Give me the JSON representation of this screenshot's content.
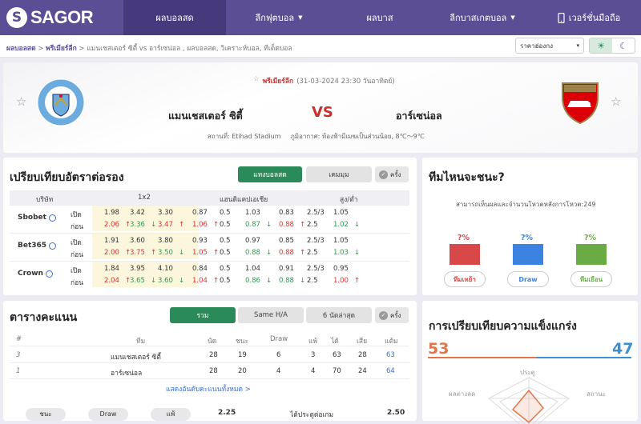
{
  "brand": {
    "logo_glyph": "S",
    "name": "SAGOR"
  },
  "nav": {
    "items": [
      "ผลบอลสด",
      "ลีกฟุตบอล",
      "ผลบาส",
      "ลีกบาสเกตบอล",
      "เวอร์ชั่นมือถือ"
    ],
    "active": 0,
    "dropdown_icon": "▼"
  },
  "breadcrumb": {
    "home": "ผลบอลสด",
    "sep": ">",
    "league": "พรีเมียร์ลีก",
    "rest": "แมนเชสเตอร์ ซิตี้ vs อาร์เซน่อล , ผลบอลสด, วิเคราะห์บอล, ทีเด็ดบอล"
  },
  "region_select": {
    "value": "ราคาฮ่องกง"
  },
  "theme": {
    "light_icon": "☀",
    "dark_icon": "☾"
  },
  "match": {
    "league": "พรีเมียร์ลีก",
    "datetime": "(31-03-2024 23:30 วันอาทิตย์)",
    "home": "แมนเชสเตอร์ ซิตี้",
    "away": "อาร์เซน่อล",
    "vs": "VS",
    "venue": "สถานที่: Etihad Stadium",
    "weather": "ภูมิอากาศ: ท้องฟ้ามีเมฆเป็นส่วนน้อย, 8℃～9℃",
    "home_crest_text": "MANCHESTER CITY",
    "away_crest_text": "Arsenal"
  },
  "odds": {
    "title": "เปรียบเทียบอัตราต่อรอง",
    "tab_active": "แทงบอลสด",
    "tab_other": "เคมมุม",
    "check": "ครั้ง",
    "head": {
      "company": "บริษัท",
      "x12": "1x2",
      "handicap": "แฮนดิแคปเอเชีย",
      "ou": "สูง/ต่ำ"
    },
    "open_label": "เปิด",
    "close_label": "ก่อน",
    "rows": [
      {
        "book": "Sbobet",
        "open": [
          "1.98",
          "3.42",
          "3.30",
          "0.87",
          "0.5",
          "1.03",
          "0.83",
          "2.5/3",
          "1.05"
        ],
        "close": [
          "2.06",
          "3.36",
          "3.47",
          "1.06",
          "0.5",
          "0.87",
          "0.88",
          "2.5",
          "1.02"
        ],
        "dir": [
          "up",
          "dn",
          "up",
          "up",
          "",
          "dn",
          "up",
          "",
          "dn"
        ]
      },
      {
        "book": "Bet365",
        "open": [
          "1.91",
          "3.60",
          "3.80",
          "0.93",
          "0.5",
          "0.97",
          "0.85",
          "2.5/3",
          "1.05"
        ],
        "close": [
          "2.00",
          "3.75",
          "3.50",
          "1.05",
          "0.5",
          "0.88",
          "0.88",
          "2.5",
          "1.03"
        ],
        "dir": [
          "up",
          "up",
          "dn",
          "up",
          "",
          "dn",
          "up",
          "",
          "dn"
        ]
      },
      {
        "book": "Crown",
        "open": [
          "1.84",
          "3.95",
          "4.10",
          "0.84",
          "0.5",
          "1.04",
          "0.91",
          "2.5/3",
          "0.95"
        ],
        "close": [
          "2.04",
          "3.65",
          "3.60",
          "1.04",
          "0.5",
          "0.86",
          "0.88",
          "2.5",
          "1.00"
        ],
        "dir": [
          "up",
          "dn",
          "dn",
          "up",
          "",
          "dn",
          "dn",
          "",
          "up"
        ]
      }
    ]
  },
  "standings": {
    "title": "ตารางคะแนน",
    "tabs": [
      "รวม",
      "Same H/A",
      "6 นัดล่าสุด"
    ],
    "check": "ครั้ง",
    "head": [
      "#",
      "ทีม",
      "นัด",
      "ชนะ",
      "Draw",
      "แพ้",
      "ได้",
      "เสีย",
      "แต้ม"
    ],
    "rows": [
      [
        "3",
        "แมนเชสเตอร์ ซิตี้",
        "28",
        "19",
        "6",
        "3",
        "63",
        "28",
        "63"
      ],
      [
        "1",
        "อาร์เซน่อล",
        "28",
        "20",
        "4",
        "4",
        "70",
        "24",
        "64"
      ]
    ],
    "show_all": "แสดงอันดับคะแนนทั้งหมด >",
    "bottom": {
      "pills": [
        "ชนะ",
        "Draw",
        "แพ้"
      ],
      "value1": "2.25",
      "label2": "ได้ประตูต่อเกม",
      "value2": "2.50"
    }
  },
  "predict": {
    "title": "ทีมไหนจะชนะ?",
    "subtitle": "สามารถเห็นผลและจำนวนโหวตหลังการโหวต:249",
    "pct": [
      "?%",
      "?%",
      "?%"
    ],
    "votes": [
      "ทีมเหย้า",
      "Draw",
      "ทีมเยือน"
    ],
    "colors": [
      "#d94848",
      "#3c82e0",
      "#6aab45"
    ]
  },
  "strength": {
    "title": "การเปรียบเทียบความแข็งแกร่ง",
    "home": "53",
    "away": "47",
    "labels": [
      "ประตู",
      "ผลต่างลด",
      "สถานะ"
    ],
    "colors": {
      "home": "#e4754a",
      "away": "#3c8fd0"
    }
  }
}
